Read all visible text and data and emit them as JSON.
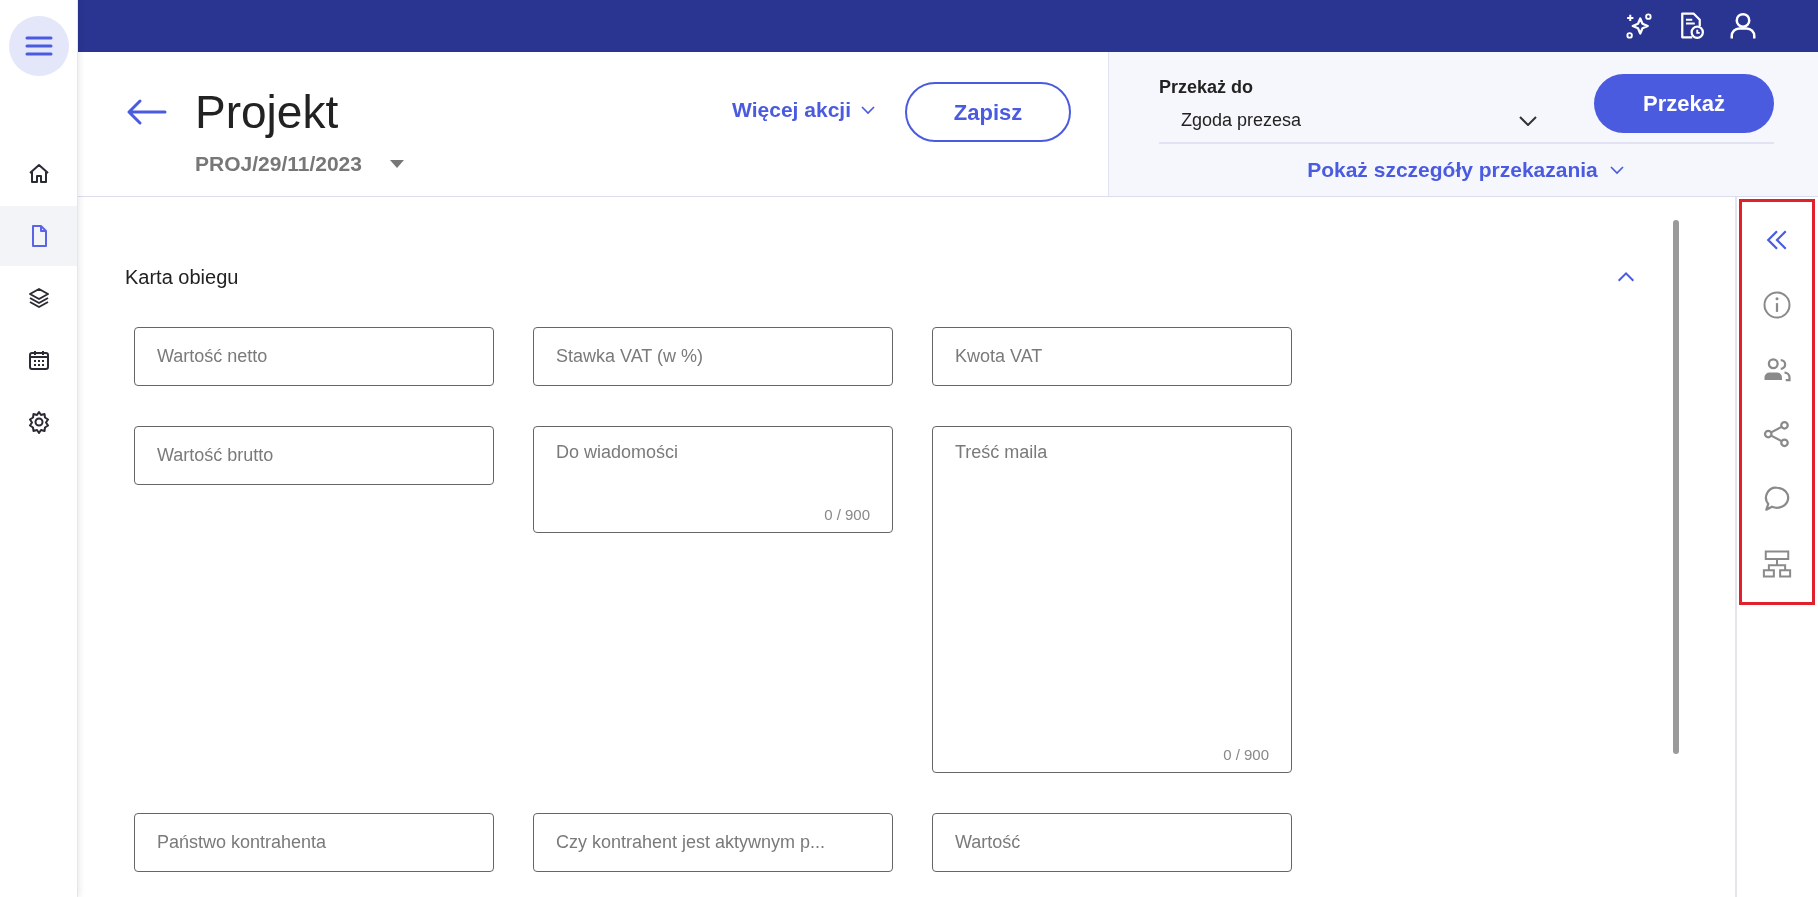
{
  "sidebar": {
    "items": [
      {
        "kind": "home",
        "selected": false
      },
      {
        "kind": "document",
        "selected": true
      },
      {
        "kind": "layers",
        "selected": false
      },
      {
        "kind": "calendar",
        "selected": false
      },
      {
        "kind": "settings",
        "selected": false
      }
    ]
  },
  "top_bar": {
    "icons": [
      {
        "kind": "sparkle"
      },
      {
        "kind": "document-clock"
      },
      {
        "kind": "user"
      }
    ]
  },
  "header": {
    "title": "Projekt",
    "document_number": "PROJ/29/11/2023",
    "more_actions": "Więcej akcji",
    "save": "Zapisz"
  },
  "transfer": {
    "label": "Przekaż do",
    "value": "Zgoda prezesa",
    "button": "Przekaż",
    "details_link": "Pokaż szczegóły przekazania"
  },
  "section": {
    "title": "Karta obiegu",
    "expanded": true,
    "fields": [
      {
        "kind": "input",
        "placeholder": "Wartość netto"
      },
      {
        "kind": "input",
        "placeholder": "Stawka VAT (w %)"
      },
      {
        "kind": "input",
        "placeholder": "Kwota VAT"
      },
      {
        "kind": "input",
        "placeholder": "Wartość brutto"
      },
      {
        "kind": "textarea",
        "placeholder": "Do wiadomości",
        "counter": "0 / 900"
      },
      {
        "kind": "large_textarea",
        "placeholder": "Treść maila",
        "counter": "0 / 900"
      },
      {
        "kind": "input",
        "placeholder": "Państwo kontrahenta"
      },
      {
        "kind": "input",
        "placeholder": "Czy kontrahent jest aktywnym p..."
      },
      {
        "kind": "input",
        "placeholder": "Wartość"
      }
    ]
  },
  "right_rail": {
    "highlighted": true,
    "icons": [
      {
        "kind": "collapse"
      },
      {
        "kind": "info"
      },
      {
        "kind": "people"
      },
      {
        "kind": "share"
      },
      {
        "kind": "comment"
      },
      {
        "kind": "hierarchy"
      }
    ]
  }
}
